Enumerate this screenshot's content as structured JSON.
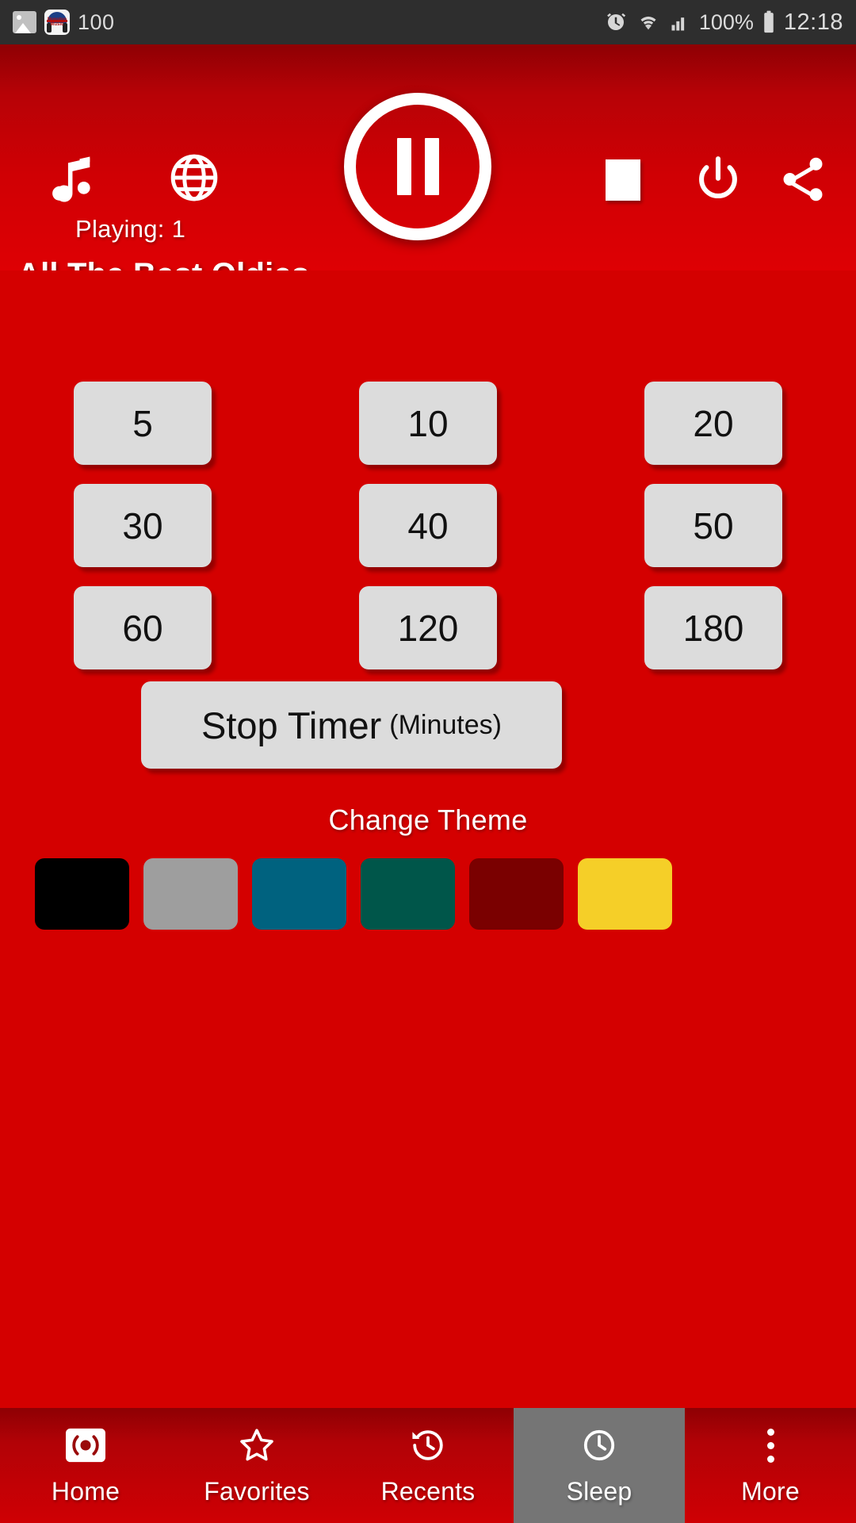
{
  "statusbar": {
    "gallery_icon": "gallery-icon",
    "app_icon_label": "Nonstop Music",
    "notification_count": "100",
    "alarm_icon": "alarm-icon",
    "wifi_icon": "wifi-icon",
    "signal_icon": "signal-icon",
    "battery_percent": "100%",
    "battery_icon": "battery-full-icon",
    "time": "12:18"
  },
  "player": {
    "music_icon": "music-note-icon",
    "globe_icon": "globe-icon",
    "play_pause_icon": "pause-icon",
    "stop_icon": "stop-icon",
    "power_icon": "power-icon",
    "share_icon": "share-icon",
    "playing_label": "Playing: 1",
    "station_title": "All The Best Oldies"
  },
  "timer": {
    "options": [
      "5",
      "10",
      "20",
      "30",
      "40",
      "50",
      "60",
      "120",
      "180"
    ],
    "stop_button_main": "Stop Timer",
    "stop_button_sub": "(Minutes)"
  },
  "theme": {
    "title": "Change Theme",
    "swatches": [
      {
        "name": "black",
        "color": "#000000"
      },
      {
        "name": "gray",
        "color": "#9e9e9e"
      },
      {
        "name": "teal-blue",
        "color": "#00627f"
      },
      {
        "name": "dark-green",
        "color": "#00564a"
      },
      {
        "name": "dark-red",
        "color": "#7a0000"
      },
      {
        "name": "yellow",
        "color": "#f5cf28"
      }
    ]
  },
  "bottomnav": {
    "items": [
      {
        "label": "Home",
        "icon": "radio-icon",
        "active": false
      },
      {
        "label": "Favorites",
        "icon": "star-icon",
        "active": false
      },
      {
        "label": "Recents",
        "icon": "history-icon",
        "active": false
      },
      {
        "label": "Sleep",
        "icon": "clock-icon",
        "active": true
      },
      {
        "label": "More",
        "icon": "overflow-menu-icon",
        "active": false
      }
    ]
  },
  "colors": {
    "background_red": "#d40000",
    "header_red_dark": "#8e0004",
    "button_gray": "#dcdcdc",
    "statusbar_dark": "#2e2e2e",
    "active_tab_gray": "#757575"
  }
}
